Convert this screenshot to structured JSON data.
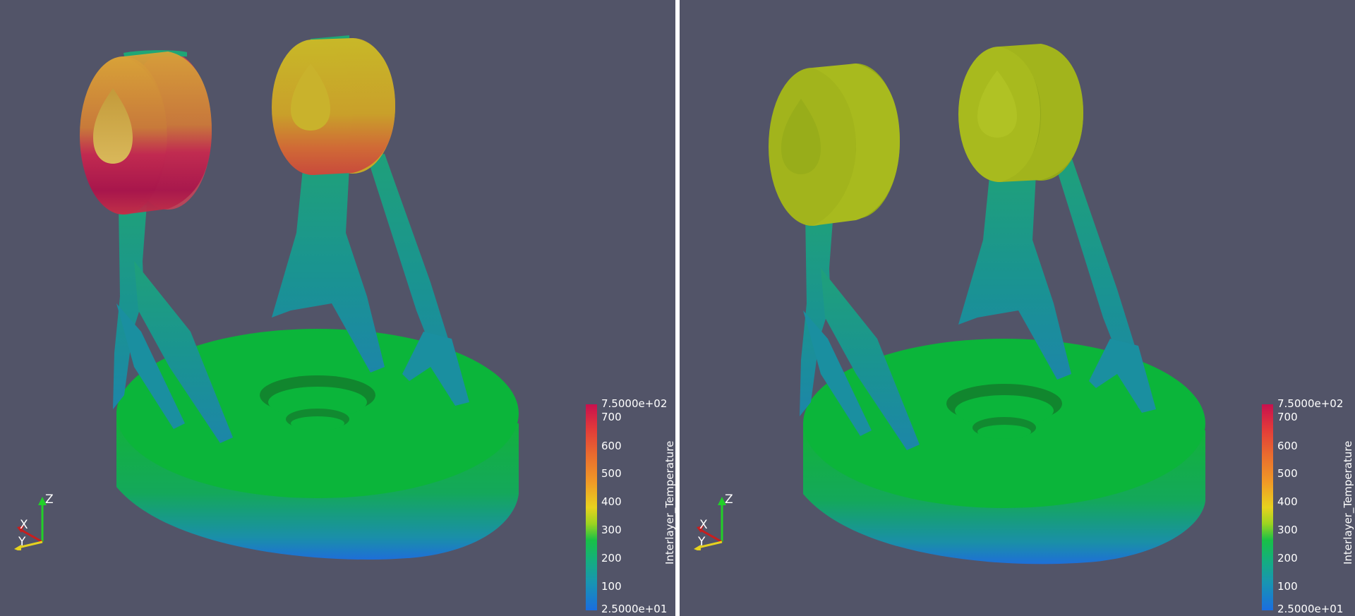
{
  "views": [
    {
      "id": "left",
      "colorbar": {
        "title": "Interlayer_Temperature",
        "max_label": "7.5000e+02",
        "min_label": "2.5000e+01",
        "ticks": [
          "700",
          "600",
          "500",
          "400",
          "300",
          "200",
          "100"
        ],
        "range": [
          25,
          750
        ]
      },
      "axes": {
        "x": "X",
        "y": "Y",
        "z": "Z"
      }
    },
    {
      "id": "right",
      "colorbar": {
        "title": "Interlayer_Temperature",
        "max_label": "7.5000e+02",
        "min_label": "2.5000e+01",
        "ticks": [
          "700",
          "600",
          "500",
          "400",
          "300",
          "200",
          "100"
        ],
        "range": [
          25,
          750
        ]
      },
      "axes": {
        "x": "X",
        "y": "Y",
        "z": "Z"
      }
    }
  ],
  "colors": {
    "background": "#525468",
    "splitter": "#ffffff",
    "base_top": "#0bb53a",
    "base_side_top": "#17a83c",
    "base_side_bottom": "#1f6fd0",
    "strut": "#1e9c8a",
    "hot": "#c2185b",
    "warm": "#e0a020",
    "yellow_ring": "#a8b820"
  }
}
